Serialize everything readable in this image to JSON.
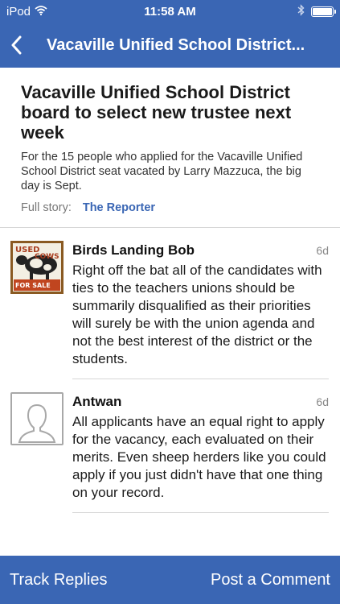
{
  "status_bar": {
    "carrier": "iPod",
    "time": "11:58 AM"
  },
  "nav": {
    "title": "Vacaville Unified School District..."
  },
  "article": {
    "title": "Vacaville Unified School District board to select new trustee next week",
    "summary": "For the 15 people who applied for the Vacaville Unified School District seat vacated by Larry Mazzuca, the big day is Sept.",
    "full_story_label": "Full story:",
    "source": "The Reporter"
  },
  "comments": [
    {
      "author": "Birds Landing Bob",
      "time": "6d",
      "body": "Right off the bat all of the candidates with ties to the teachers unions should be summarily disqualified as their priorities will surely be with the union agenda and not the best interest of the district or the students.",
      "avatar_text_top": "USED",
      "avatar_text_mid": "COWS",
      "avatar_text_bottom": "FOR SALE"
    },
    {
      "author": "Antwan",
      "time": "6d",
      "body": "All applicants have an equal right to apply for the vacancy, each evaluated on their merits.  Even sheep herders like you could apply if you just didn't have that one thing on your record."
    }
  ],
  "bottom_bar": {
    "track_replies": "Track Replies",
    "post_comment": "Post a Comment"
  },
  "colors": {
    "brand_blue": "#3a66b4",
    "link_blue": "#3a66b4"
  }
}
